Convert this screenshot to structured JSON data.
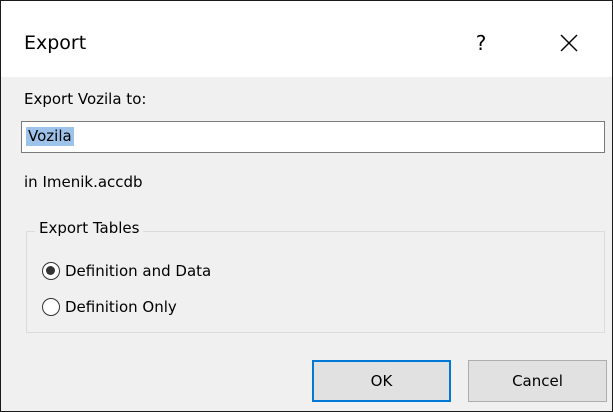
{
  "dialog": {
    "title": "Export",
    "help_label": "?",
    "close_icon": "close-icon"
  },
  "export": {
    "label": "Export Vozila to:",
    "name_value": "Vozila",
    "location_label": "in Imenik.accdb"
  },
  "export_tables": {
    "legend": "Export Tables",
    "options": [
      {
        "label": "Definition and Data",
        "checked": true
      },
      {
        "label": "Definition Only",
        "checked": false
      }
    ]
  },
  "buttons": {
    "ok_label": "OK",
    "cancel_label": "Cancel"
  },
  "colors": {
    "dialog_bg": "#f0f0f0",
    "titlebar_bg": "#ffffff",
    "selection": "#9ec3ea",
    "default_button_border": "#0078d7"
  }
}
